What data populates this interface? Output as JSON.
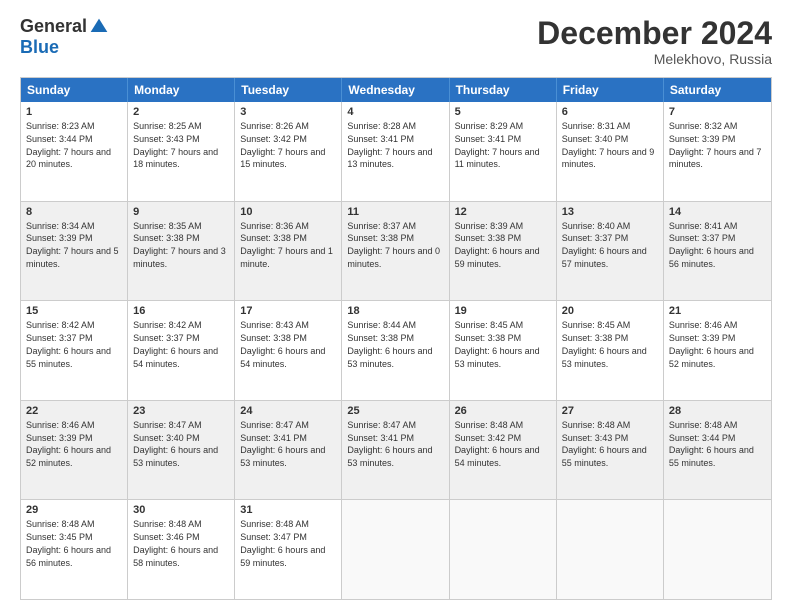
{
  "header": {
    "logo_general": "General",
    "logo_blue": "Blue",
    "month_title": "December 2024",
    "location": "Melekhovo, Russia"
  },
  "days_of_week": [
    "Sunday",
    "Monday",
    "Tuesday",
    "Wednesday",
    "Thursday",
    "Friday",
    "Saturday"
  ],
  "weeks": [
    {
      "shaded": false,
      "cells": [
        {
          "day": "1",
          "sunrise": "Sunrise: 8:23 AM",
          "sunset": "Sunset: 3:44 PM",
          "daylight": "Daylight: 7 hours and 20 minutes."
        },
        {
          "day": "2",
          "sunrise": "Sunrise: 8:25 AM",
          "sunset": "Sunset: 3:43 PM",
          "daylight": "Daylight: 7 hours and 18 minutes."
        },
        {
          "day": "3",
          "sunrise": "Sunrise: 8:26 AM",
          "sunset": "Sunset: 3:42 PM",
          "daylight": "Daylight: 7 hours and 15 minutes."
        },
        {
          "day": "4",
          "sunrise": "Sunrise: 8:28 AM",
          "sunset": "Sunset: 3:41 PM",
          "daylight": "Daylight: 7 hours and 13 minutes."
        },
        {
          "day": "5",
          "sunrise": "Sunrise: 8:29 AM",
          "sunset": "Sunset: 3:41 PM",
          "daylight": "Daylight: 7 hours and 11 minutes."
        },
        {
          "day": "6",
          "sunrise": "Sunrise: 8:31 AM",
          "sunset": "Sunset: 3:40 PM",
          "daylight": "Daylight: 7 hours and 9 minutes."
        },
        {
          "day": "7",
          "sunrise": "Sunrise: 8:32 AM",
          "sunset": "Sunset: 3:39 PM",
          "daylight": "Daylight: 7 hours and 7 minutes."
        }
      ]
    },
    {
      "shaded": true,
      "cells": [
        {
          "day": "8",
          "sunrise": "Sunrise: 8:34 AM",
          "sunset": "Sunset: 3:39 PM",
          "daylight": "Daylight: 7 hours and 5 minutes."
        },
        {
          "day": "9",
          "sunrise": "Sunrise: 8:35 AM",
          "sunset": "Sunset: 3:38 PM",
          "daylight": "Daylight: 7 hours and 3 minutes."
        },
        {
          "day": "10",
          "sunrise": "Sunrise: 8:36 AM",
          "sunset": "Sunset: 3:38 PM",
          "daylight": "Daylight: 7 hours and 1 minute."
        },
        {
          "day": "11",
          "sunrise": "Sunrise: 8:37 AM",
          "sunset": "Sunset: 3:38 PM",
          "daylight": "Daylight: 7 hours and 0 minutes."
        },
        {
          "day": "12",
          "sunrise": "Sunrise: 8:39 AM",
          "sunset": "Sunset: 3:38 PM",
          "daylight": "Daylight: 6 hours and 59 minutes."
        },
        {
          "day": "13",
          "sunrise": "Sunrise: 8:40 AM",
          "sunset": "Sunset: 3:37 PM",
          "daylight": "Daylight: 6 hours and 57 minutes."
        },
        {
          "day": "14",
          "sunrise": "Sunrise: 8:41 AM",
          "sunset": "Sunset: 3:37 PM",
          "daylight": "Daylight: 6 hours and 56 minutes."
        }
      ]
    },
    {
      "shaded": false,
      "cells": [
        {
          "day": "15",
          "sunrise": "Sunrise: 8:42 AM",
          "sunset": "Sunset: 3:37 PM",
          "daylight": "Daylight: 6 hours and 55 minutes."
        },
        {
          "day": "16",
          "sunrise": "Sunrise: 8:42 AM",
          "sunset": "Sunset: 3:37 PM",
          "daylight": "Daylight: 6 hours and 54 minutes."
        },
        {
          "day": "17",
          "sunrise": "Sunrise: 8:43 AM",
          "sunset": "Sunset: 3:38 PM",
          "daylight": "Daylight: 6 hours and 54 minutes."
        },
        {
          "day": "18",
          "sunrise": "Sunrise: 8:44 AM",
          "sunset": "Sunset: 3:38 PM",
          "daylight": "Daylight: 6 hours and 53 minutes."
        },
        {
          "day": "19",
          "sunrise": "Sunrise: 8:45 AM",
          "sunset": "Sunset: 3:38 PM",
          "daylight": "Daylight: 6 hours and 53 minutes."
        },
        {
          "day": "20",
          "sunrise": "Sunrise: 8:45 AM",
          "sunset": "Sunset: 3:38 PM",
          "daylight": "Daylight: 6 hours and 53 minutes."
        },
        {
          "day": "21",
          "sunrise": "Sunrise: 8:46 AM",
          "sunset": "Sunset: 3:39 PM",
          "daylight": "Daylight: 6 hours and 52 minutes."
        }
      ]
    },
    {
      "shaded": true,
      "cells": [
        {
          "day": "22",
          "sunrise": "Sunrise: 8:46 AM",
          "sunset": "Sunset: 3:39 PM",
          "daylight": "Daylight: 6 hours and 52 minutes."
        },
        {
          "day": "23",
          "sunrise": "Sunrise: 8:47 AM",
          "sunset": "Sunset: 3:40 PM",
          "daylight": "Daylight: 6 hours and 53 minutes."
        },
        {
          "day": "24",
          "sunrise": "Sunrise: 8:47 AM",
          "sunset": "Sunset: 3:41 PM",
          "daylight": "Daylight: 6 hours and 53 minutes."
        },
        {
          "day": "25",
          "sunrise": "Sunrise: 8:47 AM",
          "sunset": "Sunset: 3:41 PM",
          "daylight": "Daylight: 6 hours and 53 minutes."
        },
        {
          "day": "26",
          "sunrise": "Sunrise: 8:48 AM",
          "sunset": "Sunset: 3:42 PM",
          "daylight": "Daylight: 6 hours and 54 minutes."
        },
        {
          "day": "27",
          "sunrise": "Sunrise: 8:48 AM",
          "sunset": "Sunset: 3:43 PM",
          "daylight": "Daylight: 6 hours and 55 minutes."
        },
        {
          "day": "28",
          "sunrise": "Sunrise: 8:48 AM",
          "sunset": "Sunset: 3:44 PM",
          "daylight": "Daylight: 6 hours and 55 minutes."
        }
      ]
    },
    {
      "shaded": false,
      "cells": [
        {
          "day": "29",
          "sunrise": "Sunrise: 8:48 AM",
          "sunset": "Sunset: 3:45 PM",
          "daylight": "Daylight: 6 hours and 56 minutes."
        },
        {
          "day": "30",
          "sunrise": "Sunrise: 8:48 AM",
          "sunset": "Sunset: 3:46 PM",
          "daylight": "Daylight: 6 hours and 58 minutes."
        },
        {
          "day": "31",
          "sunrise": "Sunrise: 8:48 AM",
          "sunset": "Sunset: 3:47 PM",
          "daylight": "Daylight: 6 hours and 59 minutes."
        },
        {
          "day": "",
          "sunrise": "",
          "sunset": "",
          "daylight": ""
        },
        {
          "day": "",
          "sunrise": "",
          "sunset": "",
          "daylight": ""
        },
        {
          "day": "",
          "sunrise": "",
          "sunset": "",
          "daylight": ""
        },
        {
          "day": "",
          "sunrise": "",
          "sunset": "",
          "daylight": ""
        }
      ]
    }
  ]
}
